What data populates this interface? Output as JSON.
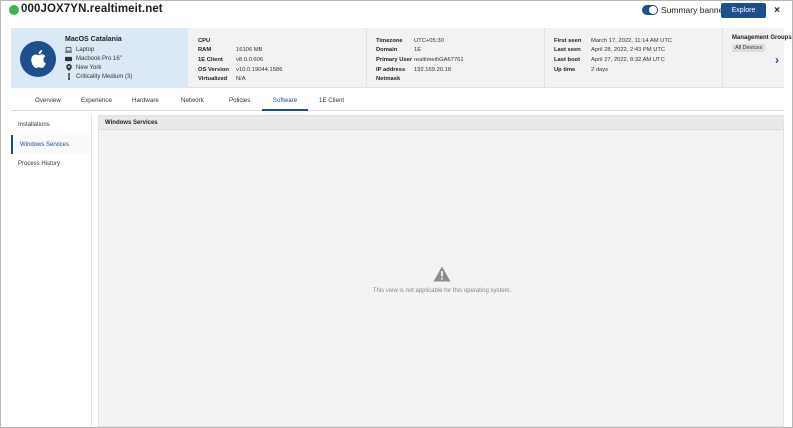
{
  "header": {
    "device_title": "000JOX7YN.realtimeit.net",
    "status_color": "#3fb34f",
    "toggle_label": "Summary banner",
    "explore_label": "Explore",
    "close_label": "×"
  },
  "device": {
    "name": "MacOS Catalania",
    "type": "Laptop",
    "model": "Macbook Pro 16\"",
    "location": "New York",
    "criticality": "Criticality Medium (3)"
  },
  "hardware": [
    {
      "k": "CPU",
      "v": ""
    },
    {
      "k": "RAM",
      "v": "16106 MB"
    },
    {
      "k": "1E Client",
      "v": "v8.0.0.606"
    },
    {
      "k": "OS Version",
      "v": "v10.0.19044.1586"
    },
    {
      "k": "Virtualized",
      "v": "N/A"
    }
  ],
  "network": [
    {
      "k": "Timezone",
      "v": "UTC+05:30"
    },
    {
      "k": "Domain",
      "v": "1E"
    },
    {
      "k": "Primary User",
      "v": "realtimeit\\GA67761"
    },
    {
      "k": "IP address",
      "v": "192.169.20.18"
    },
    {
      "k": "Netmask",
      "v": ""
    }
  ],
  "times": [
    {
      "k": "First seen",
      "v": "March 17, 2022, 11:14 AM UTC"
    },
    {
      "k": "Last seen",
      "v": "April 28, 2022, 2:43 PM UTC"
    },
    {
      "k": "Last boot",
      "v": "April 27, 2022, 8:32 AM UTC"
    },
    {
      "k": "Up time",
      "v": "2 days"
    }
  ],
  "management": {
    "label": "Management Groups",
    "badge": "All Devices"
  },
  "tabs": [
    "Overview",
    "Experience",
    "Hardware",
    "Network",
    "Policies",
    "Software",
    "1E Client"
  ],
  "active_tab": "Software",
  "leftnav": [
    "Installations",
    "Windows Services",
    "Process History"
  ],
  "active_nav": "Windows Services",
  "panel": {
    "title": "Windows Services",
    "message": "This view is not applicable for this operating system."
  },
  "colors": {
    "accent": "#1f4e8c",
    "banner_card": "#dbe8f5",
    "status_online": "#3fb34f"
  },
  "icons": [
    "apple-icon",
    "laptop-icon",
    "model-icon",
    "location-pin-icon",
    "criticality-icon",
    "chevron-right-icon",
    "warning-icon",
    "close-icon"
  ]
}
